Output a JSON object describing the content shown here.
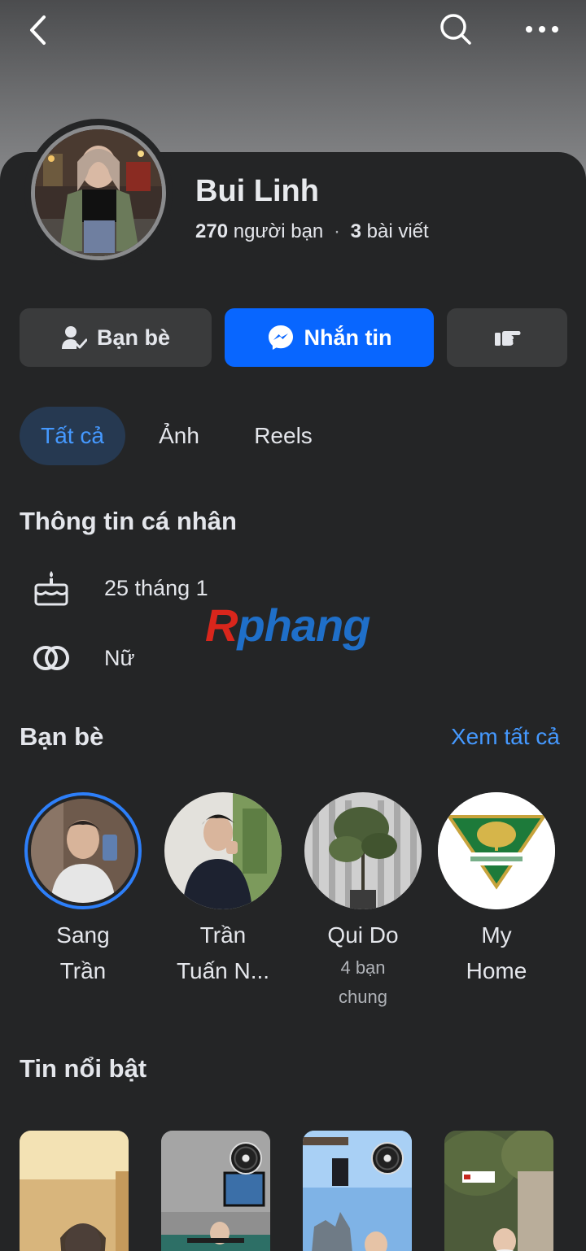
{
  "header": {
    "back_icon": "chevron-left-icon",
    "search_icon": "search-icon",
    "more_icon": "more-horizontal-icon"
  },
  "profile": {
    "name": "Bui Linh",
    "friends_count": "270",
    "friends_label": "người bạn",
    "separator": "·",
    "posts_count": "3",
    "posts_label": "bài viết"
  },
  "actions": {
    "friends_label": "Bạn bè",
    "message_label": "Nhắn tin",
    "poke_icon": "poke-hand-icon",
    "message_color": "#0866ff"
  },
  "tabs": [
    {
      "label": "Tất cả",
      "active": true
    },
    {
      "label": "Ảnh",
      "active": false
    },
    {
      "label": "Reels",
      "active": false
    }
  ],
  "about": {
    "title": "Thông tin cá nhân",
    "birthday": "25 tháng 1",
    "gender": "Nữ"
  },
  "watermark": {
    "first": "R",
    "rest": "phang"
  },
  "friends": {
    "title": "Bạn bè",
    "see_all": "Xem tất cả",
    "items": [
      {
        "name_line1": "Sang",
        "name_line2": "Trần",
        "mutual_line1": "",
        "mutual_line2": ""
      },
      {
        "name_line1": "Trần",
        "name_line2": "Tuấn N...",
        "mutual_line1": "",
        "mutual_line2": ""
      },
      {
        "name_line1": "Qui Do",
        "name_line2": "",
        "mutual_line1": "4 bạn",
        "mutual_line2": "chung"
      },
      {
        "name_line1": "My",
        "name_line2": "Home",
        "mutual_line1": "",
        "mutual_line2": ""
      }
    ]
  },
  "highlights": {
    "title": "Tin nổi bật"
  },
  "colors": {
    "background": "#242526",
    "accent": "#0866ff",
    "link": "#4599ff"
  }
}
